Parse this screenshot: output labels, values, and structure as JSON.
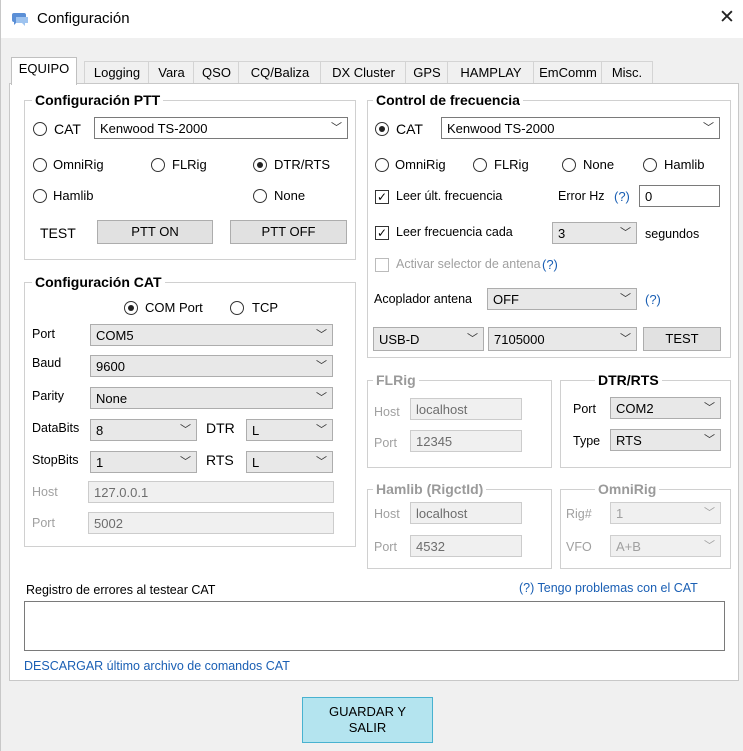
{
  "window": {
    "title": "Configuración",
    "close": "✕"
  },
  "tabs": [
    "EQUIPO",
    "Logging",
    "Vara",
    "QSO",
    "CQ/Baliza",
    "DX Cluster",
    "GPS",
    "HAMPLAY",
    "EmComm",
    "Misc."
  ],
  "ptt": {
    "title": "Configuración PTT",
    "cat_label": "CAT",
    "cat_radio": "Kenwood TS-2000",
    "omnirig": "OmniRig",
    "flrig": "FLRig",
    "dtr_rts": "DTR/RTS",
    "hamlib": "Hamlib",
    "none": "None",
    "test_label": "TEST",
    "ptt_on": "PTT ON",
    "ptt_off": "PTT OFF",
    "selected": "DTR/RTS"
  },
  "cat": {
    "title": "Configuración CAT",
    "com_port": "COM Port",
    "tcp": "TCP",
    "port_label": "Port",
    "port_value": "COM5",
    "baud_label": "Baud",
    "baud_value": "9600",
    "parity_label": "Parity",
    "parity_value": "None",
    "databits_label": "DataBits",
    "databits_value": "8",
    "dtr_label": "DTR",
    "dtr_value": "L",
    "stopbits_label": "StopBits",
    "stopbits_value": "1",
    "rts_label": "RTS",
    "rts_value": "L",
    "host_label": "Host",
    "host_value": "127.0.0.1",
    "tcp_port_label": "Port",
    "tcp_port_value": "5002"
  },
  "freq": {
    "title": "Control de frecuencia",
    "cat_label": "CAT",
    "cat_radio": "Kenwood TS-2000",
    "omnirig": "OmniRig",
    "flrig": "FLRig",
    "none": "None",
    "hamlib": "Hamlib",
    "read_last": "Leer últ. frecuencia",
    "error_hz": "Error Hz",
    "help": "(?)",
    "error_value": "0",
    "read_every": "Leer frecuencia cada",
    "every_value": "3",
    "seconds": "segundos",
    "antenna_selector": "Activar selector de antena",
    "coupler_label": "Acoplador antena",
    "coupler_value": "OFF",
    "mode_value": "USB-D",
    "freq_value": "7105000",
    "test": "TEST"
  },
  "flrig": {
    "title": "FLRig",
    "host_label": "Host",
    "host_value": "localhost",
    "port_label": "Port",
    "port_value": "12345"
  },
  "dtrrts": {
    "title": "DTR/RTS",
    "port_label": "Port",
    "port_value": "COM2",
    "type_label": "Type",
    "type_value": "RTS"
  },
  "hamlib": {
    "title": "Hamlib (RigctId)",
    "host_label": "Host",
    "host_value": "localhost",
    "port_label": "Port",
    "port_value": "4532"
  },
  "omnirig": {
    "title": "OmniRig",
    "rig_label": "Rig#",
    "rig_value": "1",
    "vfo_label": "VFO",
    "vfo_value": "A+B"
  },
  "errors": {
    "label": "Registro de errores al testear CAT",
    "help_link": "(?) Tengo problemas con el CAT",
    "download_link": "DESCARGAR último archivo de comandos CAT"
  },
  "footer": {
    "save": "GUARDAR Y SALIR"
  },
  "colors": {
    "accent_link": "#1a5fb4",
    "save_bg": "#b4e4ef"
  }
}
